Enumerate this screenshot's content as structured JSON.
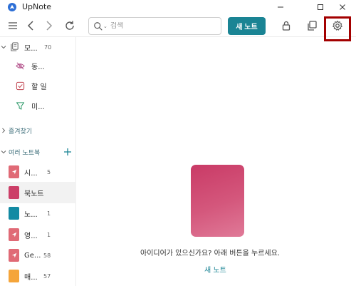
{
  "window": {
    "title": "UpNote",
    "minimize_icon": "minimize-icon",
    "maximize_icon": "maximize-icon",
    "close_icon": "close-icon"
  },
  "toolbar": {
    "search_placeholder": "검색",
    "new_note_label": "새 노트",
    "icons": [
      "menu-icon",
      "back-arrow-icon",
      "forward-arrow-icon",
      "refresh-icon",
      "lock-icon",
      "copy-window-icon",
      "gear-icon"
    ]
  },
  "sidebar": {
    "all_notes": {
      "label": "모...",
      "count": "70"
    },
    "sub_items": [
      {
        "label": "동...",
        "icon": "eye-off-icon"
      },
      {
        "label": "할 일",
        "icon": "checkbox-icon"
      },
      {
        "label": "미...",
        "icon": "filter-icon"
      }
    ],
    "favorites_label": "즐겨찾기",
    "notebooks_label": "여러 노트북",
    "notebooks": [
      {
        "label": "시...",
        "count": "5",
        "color": "#e06a76",
        "icon": "send-icon"
      },
      {
        "label": "북노트",
        "count": "",
        "color": "#cc3f68",
        "icon": ""
      },
      {
        "label": "노...",
        "count": "1",
        "color": "#138aa3",
        "icon": ""
      },
      {
        "label": "영...",
        "count": "1",
        "color": "#e06a76",
        "icon": "send-icon"
      },
      {
        "label": "Ge...",
        "count": "58",
        "color": "#e06a76",
        "icon": "send-icon"
      },
      {
        "label": "매...",
        "count": "57",
        "color": "#f5a53a",
        "icon": ""
      }
    ]
  },
  "main": {
    "empty_message": "아이디어가 있으신가요? 아래 버튼을 누르세요.",
    "empty_link": "새 노트"
  },
  "colors": {
    "accent": "#1a8494",
    "highlight_border": "#a30000"
  }
}
